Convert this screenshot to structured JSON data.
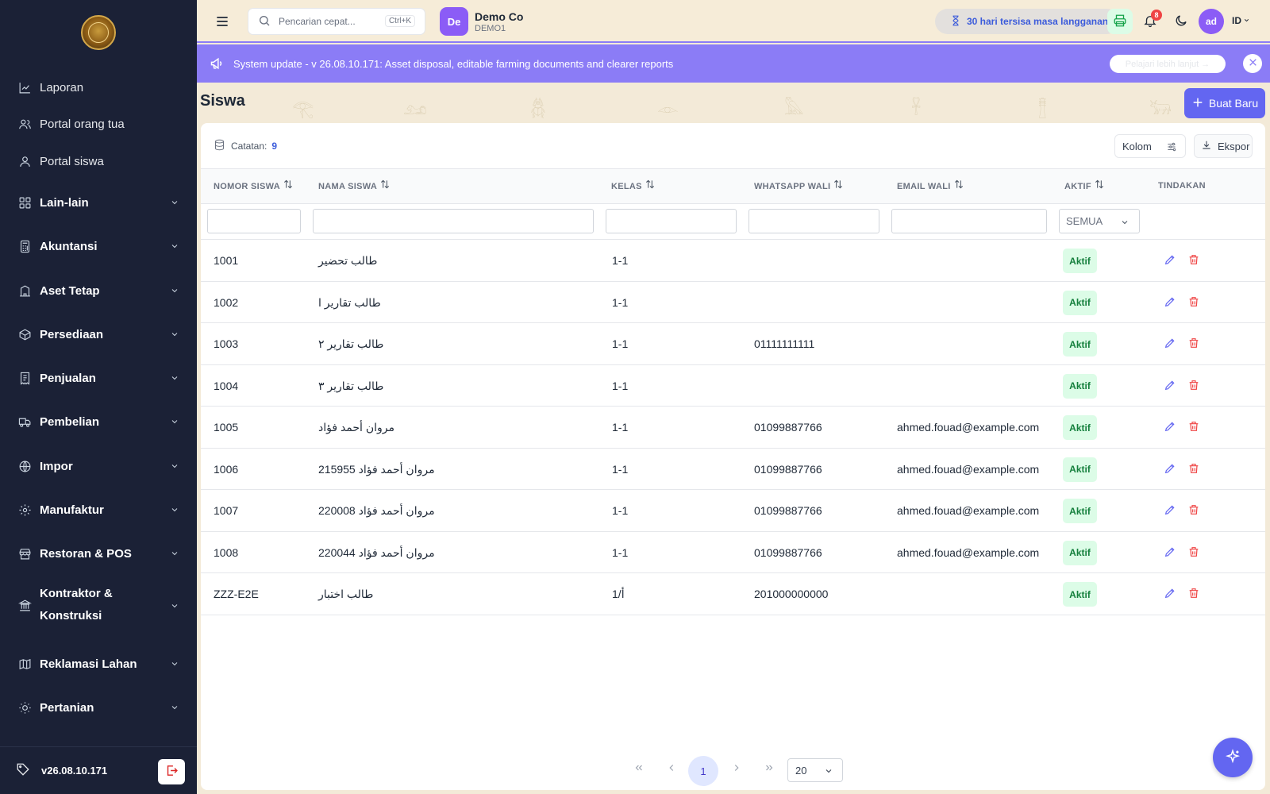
{
  "sidebar": {
    "items": [
      {
        "label": "Laporan",
        "icon": "chart-line-icon"
      },
      {
        "label": "Portal orang tua",
        "icon": "users-icon"
      },
      {
        "label": "Portal siswa",
        "icon": "user-icon"
      },
      {
        "label": "Lain-lain",
        "icon": "grid-icon"
      },
      {
        "label": "Akuntansi",
        "icon": "calculator-icon"
      },
      {
        "label": "Aset Tetap",
        "icon": "building-icon"
      },
      {
        "label": "Persediaan",
        "icon": "package-icon"
      },
      {
        "label": "Penjualan",
        "icon": "receipt-icon"
      },
      {
        "label": "Pembelian",
        "icon": "truck-icon"
      },
      {
        "label": "Impor",
        "icon": "globe-icon"
      },
      {
        "label": "Manufaktur",
        "icon": "cog-icon"
      },
      {
        "label": "Restoran & POS",
        "icon": "store-icon"
      },
      {
        "label": "Kontraktor & Konstruksi",
        "icon": "landmark-icon"
      },
      {
        "label": "Reklamasi Lahan",
        "icon": "map-icon"
      },
      {
        "label": "Pertanian",
        "icon": "sun-icon"
      }
    ],
    "version": "v26.08.10.171"
  },
  "topbar": {
    "search_placeholder": "Pencarian cepat...",
    "shortcut": "Ctrl+K",
    "company_initials": "De",
    "company_name": "Demo Co",
    "company_code": "DEMO1",
    "subscription": "30 hari tersisa masa langganan",
    "notification_count": "8",
    "user_initials": "ad",
    "language": "ID"
  },
  "banner": {
    "message": "System update - v 26.08.10.171: Asset disposal, editable farming documents and clearer reports",
    "learn_more": "Pelajari lebih lanjut →"
  },
  "page": {
    "title": "Siswa",
    "create_label": "Buat Baru"
  },
  "toolbar": {
    "records_label": "Catatan:",
    "records_count": "9",
    "columns_label": "Kolom",
    "export_label": "Ekspor"
  },
  "table": {
    "headers": [
      "NOMOR SISWA",
      "NAMA SISWA",
      "KELAS",
      "WHATSAPP WALI",
      "EMAIL WALI",
      "AKTIF",
      "TINDAKAN"
    ],
    "status_filter": "SEMUA",
    "rows": [
      {
        "id": "1001",
        "name": "طالب تحضير",
        "class": "1-1",
        "whatsapp": "",
        "email": "",
        "status": "Aktif"
      },
      {
        "id": "1002",
        "name": "طالب تقارير ا",
        "class": "1-1",
        "whatsapp": "",
        "email": "",
        "status": "Aktif"
      },
      {
        "id": "1003",
        "name": "طالب تقارير ٢",
        "class": "1-1",
        "whatsapp": "01111111111",
        "email": "",
        "status": "Aktif"
      },
      {
        "id": "1004",
        "name": "طالب تقارير ٣",
        "class": "1-1",
        "whatsapp": "",
        "email": "",
        "status": "Aktif"
      },
      {
        "id": "1005",
        "name": "مروان أحمد فؤاد",
        "class": "1-1",
        "whatsapp": "01099887766",
        "email": "ahmed.fouad@example.com",
        "status": "Aktif"
      },
      {
        "id": "1006",
        "name": "مروان أحمد فؤاد 215955",
        "class": "1-1",
        "whatsapp": "01099887766",
        "email": "ahmed.fouad@example.com",
        "status": "Aktif"
      },
      {
        "id": "1007",
        "name": "مروان أحمد فؤاد 220008",
        "class": "1-1",
        "whatsapp": "01099887766",
        "email": "ahmed.fouad@example.com",
        "status": "Aktif"
      },
      {
        "id": "1008",
        "name": "مروان أحمد فؤاد 220044",
        "class": "1-1",
        "whatsapp": "01099887766",
        "email": "ahmed.fouad@example.com",
        "status": "Aktif"
      },
      {
        "id": "ZZZ-E2E",
        "name": "طالب اختبار",
        "class": "1/أ",
        "whatsapp": "201000000000",
        "email": "",
        "status": "Aktif"
      }
    ]
  },
  "pagination": {
    "current_page": "1",
    "page_size": "20"
  },
  "colors": {
    "sidebar_bg": "#1b2136",
    "accent": "#6366f1",
    "banner_bg": "#8b7cf6",
    "active_green": "#15803d",
    "danger": "#ef4444"
  }
}
